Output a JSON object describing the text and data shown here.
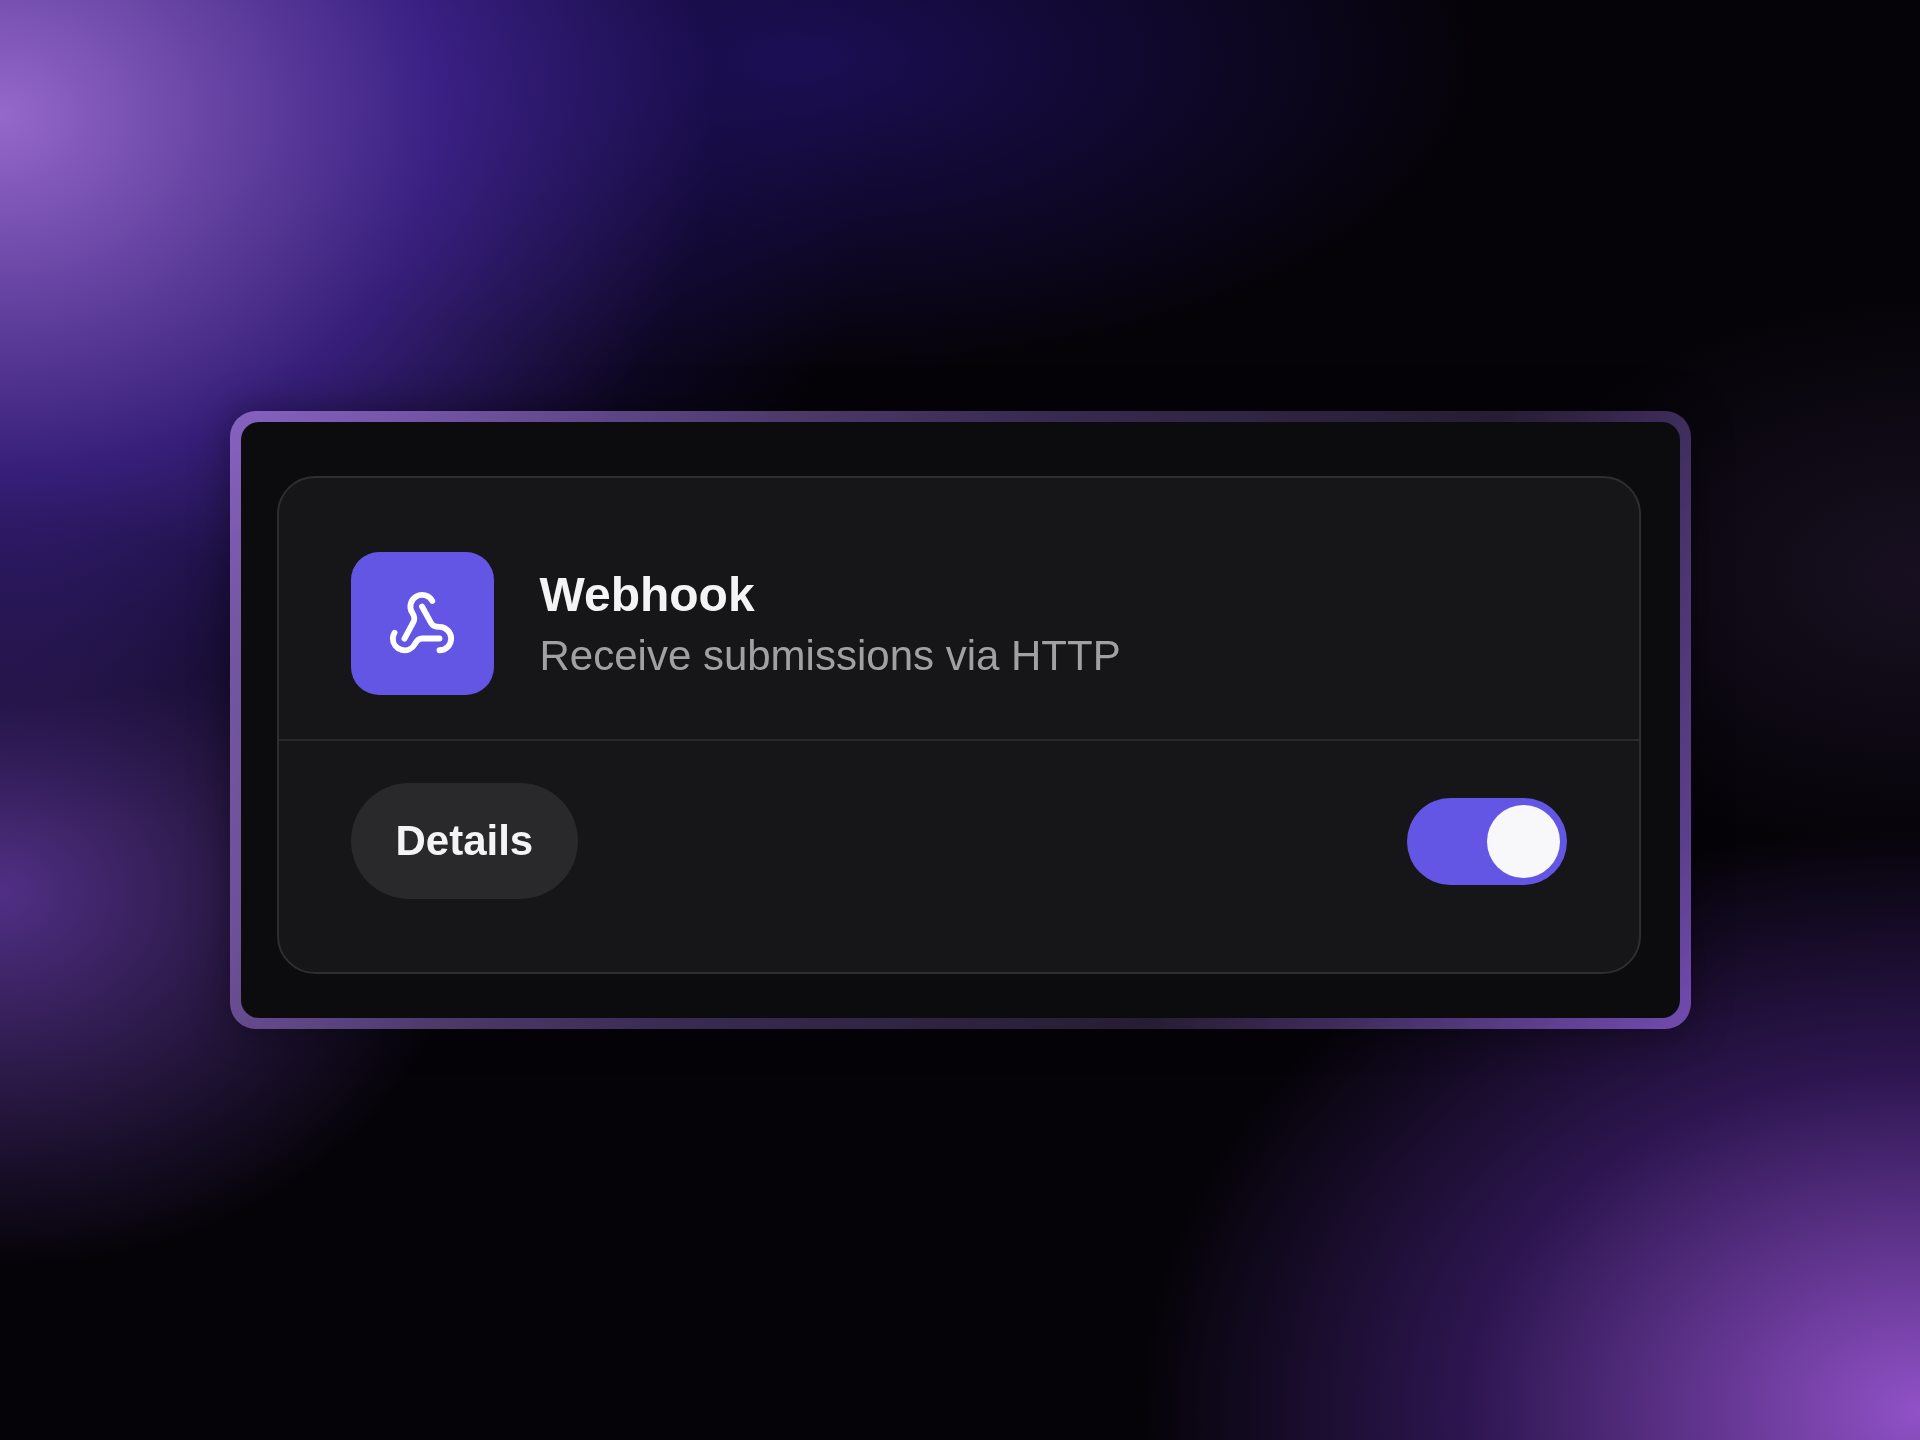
{
  "integration": {
    "title": "Webhook",
    "description": "Receive submissions via HTTP"
  },
  "details_button": {
    "label": "Details"
  },
  "toggle": {
    "on": true
  }
}
